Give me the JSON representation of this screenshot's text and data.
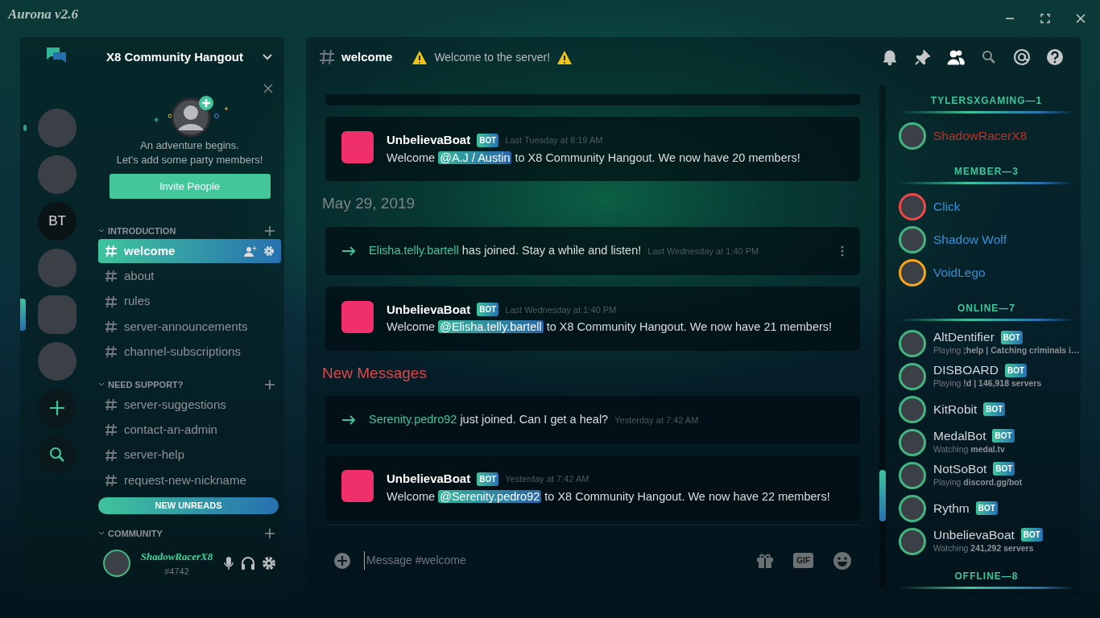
{
  "app_title": "Aurona v2.6",
  "servers": [
    {
      "kind": "photo",
      "selected": false,
      "unread": true
    },
    {
      "kind": "photo",
      "selected": false,
      "unread": false
    },
    {
      "kind": "initials",
      "label": "BT",
      "selected": false,
      "unread": false
    },
    {
      "kind": "photo",
      "selected": false,
      "unread": false
    },
    {
      "kind": "photo",
      "selected": true,
      "unread": false
    },
    {
      "kind": "photo",
      "selected": false,
      "unread": false
    }
  ],
  "server_name": "X8 Community Hangout",
  "invite_card": {
    "lines": [
      "An adventure begins.",
      "Let's add some party members!"
    ],
    "button": "Invite People"
  },
  "categories": [
    {
      "name": "INTRODUCTION",
      "expanded": true,
      "channels": [
        {
          "name": "welcome",
          "selected": true
        },
        {
          "name": "about",
          "selected": false
        },
        {
          "name": "rules",
          "selected": false
        },
        {
          "name": "server-announcements",
          "selected": false
        },
        {
          "name": "channel-subscriptions",
          "selected": false
        }
      ]
    },
    {
      "name": "NEED SUPPORT?",
      "expanded": true,
      "channels": [
        {
          "name": "server-suggestions",
          "selected": false
        },
        {
          "name": "contact-an-admin",
          "selected": false
        },
        {
          "name": "server-help",
          "selected": false
        },
        {
          "name": "request-new-nickname",
          "selected": false
        }
      ]
    },
    {
      "name": "COMMUNITY",
      "expanded": true
    }
  ],
  "new_unreads": "NEW UNREADS",
  "user": {
    "name": "ShadowRacerX8",
    "tag": "#4742"
  },
  "header": {
    "channel": "welcome",
    "topic": "Welcome to the server!"
  },
  "toolbar": [
    {
      "kind": "bell",
      "selected": false
    },
    {
      "kind": "pin",
      "selected": false
    },
    {
      "kind": "members",
      "selected": true
    },
    {
      "kind": "search",
      "selected": false
    },
    {
      "kind": "mention",
      "selected": false
    },
    {
      "kind": "help",
      "selected": false
    }
  ],
  "messages": [
    {
      "kind": "partial"
    },
    {
      "kind": "message",
      "author": "UnbelievaBoat",
      "badge": "BOT",
      "time": "Last Tuesday at 8:19 AM",
      "before": "Welcome ",
      "mention": "@A.J / Austin",
      "after": " to X8 Community Hangout. We now have 20 members!"
    },
    {
      "kind": "date",
      "text": "May 29, 2019"
    },
    {
      "kind": "join",
      "user": "Elisha.telly.bartell",
      "text": " has joined. Stay a while and listen!",
      "time": "Last Wednesday at 1:40 PM",
      "hovered": true
    },
    {
      "kind": "message",
      "author": "UnbelievaBoat",
      "badge": "BOT",
      "time": "Last Wednesday at 1:40 PM",
      "before": "Welcome ",
      "mention": "@Elisha.telly.bartell",
      "after": " to X8 Community Hangout. We now have 21 members!"
    },
    {
      "kind": "new",
      "text": "New Messages"
    },
    {
      "kind": "join",
      "user": "Serenity.pedro92",
      "text": " just joined. Can I get a heal?",
      "time": "Yesterday at 7:42 AM",
      "hovered": false
    },
    {
      "kind": "message",
      "author": "UnbelievaBoat",
      "badge": "BOT",
      "time": "Yesterday at 7:42 AM",
      "before": "Welcome ",
      "mention": "@Serenity.pedro92",
      "after": " to X8 Community Hangout. We now have 22 members!"
    }
  ],
  "composer": {
    "placeholder": "Message #welcome",
    "gif_label": "GIF"
  },
  "member_groups": [
    {
      "title": "TYLERSXGAMING—1",
      "members": [
        {
          "name": "ShadowRacerX8",
          "color": "#b8352b",
          "idle": false,
          "dnd": false
        }
      ]
    },
    {
      "title": "MEMBER—3",
      "members": [
        {
          "name": "Click",
          "color": "#3a8fd6",
          "idle": false,
          "dnd": true
        },
        {
          "name": "Shadow Wolf",
          "color": "#3a8fd6",
          "idle": false,
          "dnd": false
        },
        {
          "name": "VoidLego",
          "color": "#3a8fd6",
          "idle": true,
          "dnd": false
        }
      ]
    },
    {
      "title": "ONLINE—7",
      "members": [
        {
          "name": "AltDentifier",
          "color": "#d4d6d9",
          "idle": false,
          "dnd": false,
          "badge": "BOT",
          "activity": "Playing **;help | Catching criminals i…**"
        },
        {
          "name": "DISBOARD",
          "color": "#d4d6d9",
          "idle": false,
          "dnd": false,
          "badge": "BOT",
          "activity": "Playing **!d | 146,918 servers**"
        },
        {
          "name": "KitRobit",
          "color": "#d4d6d9",
          "idle": false,
          "dnd": false,
          "badge": "BOT"
        },
        {
          "name": "MedalBot",
          "color": "#d4d6d9",
          "idle": false,
          "dnd": false,
          "badge": "BOT",
          "activity": "Watching **medal.tv**"
        },
        {
          "name": "NotSoBot",
          "color": "#d4d6d9",
          "idle": false,
          "dnd": false,
          "badge": "BOT",
          "activity": "Playing **discord.gg/bot**"
        },
        {
          "name": "Rythm",
          "color": "#d4d6d9",
          "idle": false,
          "dnd": false,
          "badge": "BOT"
        },
        {
          "name": "UnbelievaBoat",
          "color": "#d4d6d9",
          "idle": false,
          "dnd": false,
          "badge": "BOT",
          "activity": "Watching **241,292 servers**"
        }
      ]
    },
    {
      "title": "OFFLINE—8"
    }
  ]
}
